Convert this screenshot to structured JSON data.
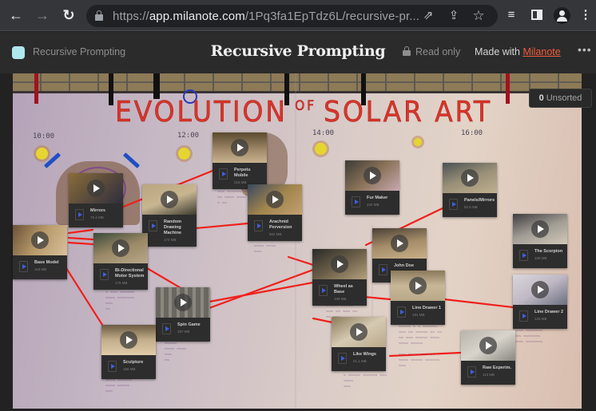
{
  "browser": {
    "url_scheme": "https://",
    "url_host": "app.milanote.com",
    "url_path": "/1Pq3fa1EpTdz6L/recursive-pr...",
    "icons": [
      "back-icon",
      "forward-icon",
      "reload-icon",
      "lock-icon",
      "open-in-app-icon",
      "share-icon",
      "bookmark-star-icon",
      "reading-list-icon",
      "side-panel-icon",
      "profile-icon",
      "menu-icon"
    ]
  },
  "header": {
    "breadcrumb": "Recursive Prompting",
    "board_color": "#aee8ec",
    "title": "Recursive Prompting",
    "read_only": "Read only",
    "made_with_prefix": "Made with ",
    "made_with_link": "Milanote",
    "brand_color": "#f15b3b",
    "more": "•••"
  },
  "unsorted": {
    "count": "0",
    "label": " Unsorted"
  },
  "poster": {
    "title_left": "EVOLUTION",
    "title_of": "OF",
    "title_right": "SOLAR ART",
    "times": [
      "10:00",
      "12:00",
      "14:00",
      "16:00"
    ]
  },
  "cards": [
    {
      "name": "Mirrors",
      "size": "75.4 MB"
    },
    {
      "name": "Perpetu Mobile",
      "size": "215 MB"
    },
    {
      "name": "Random Drawing Machine",
      "size": "172 MB"
    },
    {
      "name": "Arachnid Perversion",
      "size": "502 MB"
    },
    {
      "name": "Base Model",
      "size": "118 MB"
    },
    {
      "name": "Bi-Directional Motor System",
      "size": "175 MB"
    },
    {
      "name": "Spin Game",
      "size": "287 MB"
    },
    {
      "name": "Sculpture",
      "size": "158 MB"
    },
    {
      "name": "Fur Maker",
      "size": "232 MB"
    },
    {
      "name": "Panels/Mirrors",
      "size": "52.6 MB"
    },
    {
      "name": "John Doe",
      "size": ""
    },
    {
      "name": "Wheel as Base",
      "size": "169 MB"
    },
    {
      "name": "Line Drawer 1",
      "size": "181 MB"
    },
    {
      "name": "The Scorpion",
      "size": "108 MB"
    },
    {
      "name": "Line Drawer 2",
      "size": "126 MB"
    },
    {
      "name": "Like Wings",
      "size": "51.1 MB"
    },
    {
      "name": "Raw Experim.",
      "size": "115 MB"
    }
  ]
}
